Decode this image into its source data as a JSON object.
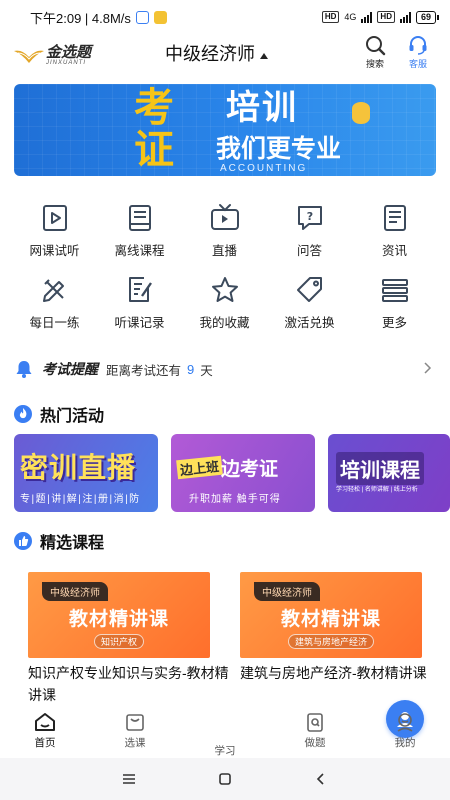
{
  "status_bar": {
    "time_speed": "下午2:09 | 4.8M/s",
    "battery": "69",
    "network": "4G"
  },
  "header": {
    "logo_text": "金选题",
    "logo_sub": "JINXUANTI",
    "title": "中级经济师",
    "search_label": "搜索",
    "service_label": "客服"
  },
  "banner": {
    "char_kao": "考",
    "text_peixun": "培训",
    "char_zheng": "证",
    "slogan": "我们更专业",
    "sub": "ACCOUNTING"
  },
  "grid": {
    "row1": [
      {
        "label": "网课试听",
        "icon": "video-course-icon"
      },
      {
        "label": "离线课程",
        "icon": "offline-book-icon"
      },
      {
        "label": "直播",
        "icon": "tv-live-icon"
      },
      {
        "label": "问答",
        "icon": "question-bubble-icon"
      },
      {
        "label": "资讯",
        "icon": "news-doc-icon"
      }
    ],
    "row2": [
      {
        "label": "每日一练",
        "icon": "pencil-ruler-icon"
      },
      {
        "label": "听课记录",
        "icon": "notes-edit-icon"
      },
      {
        "label": "我的收藏",
        "icon": "star-icon"
      },
      {
        "label": "激活兑换",
        "icon": "ticket-icon"
      },
      {
        "label": "更多",
        "icon": "stack-icon"
      }
    ]
  },
  "notice": {
    "bold": "考试提醒",
    "text_before": "距离考试还有",
    "days": "9",
    "text_after": "天"
  },
  "hot": {
    "title": "热门活动",
    "items": [
      {
        "title": "密训直播",
        "sub": "专|题|讲|解|注|册|消|防"
      },
      {
        "pre": "边上班",
        "title": "边考证",
        "sub": "升职加薪  触手可得"
      },
      {
        "title": "培训课程",
        "sub": "学习轻松 | 名师讲解 | 线上分析"
      }
    ]
  },
  "selected": {
    "title": "精选课程",
    "courses": [
      {
        "tag": "中级经济师",
        "thumb_title": "教材精讲课",
        "thumb_sub": "知识产权",
        "name": "知识产权专业知识与实务-教材精讲课"
      },
      {
        "tag": "中级经济师",
        "thumb_title": "教材精讲课",
        "thumb_sub": "建筑与房地产经济",
        "name": "建筑与房地产经济-教材精讲课"
      }
    ]
  },
  "bottom_nav": {
    "items": [
      {
        "label": "首页"
      },
      {
        "label": "选课"
      },
      {
        "label": "学习"
      },
      {
        "label": "做题"
      },
      {
        "label": "我的"
      }
    ]
  },
  "colors": {
    "accent": "#3b7ff2",
    "banner_yellow": "#f6c417",
    "course_orange": "#ff7f35"
  }
}
